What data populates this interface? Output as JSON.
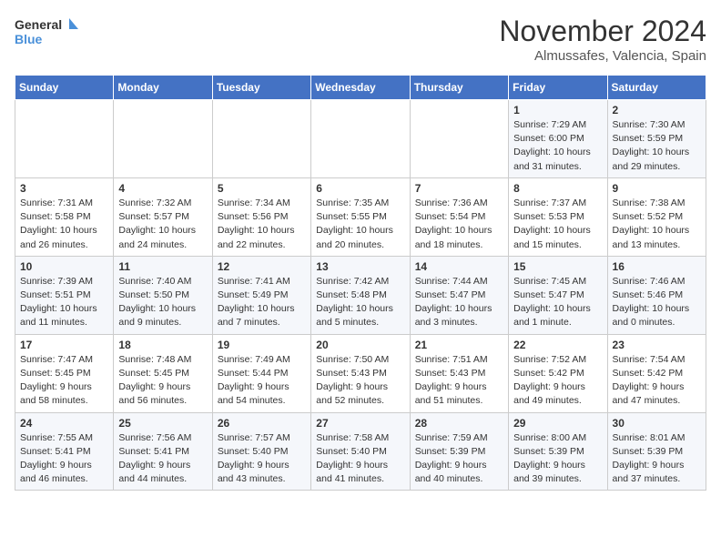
{
  "logo": {
    "line1": "General",
    "line2": "Blue"
  },
  "title": "November 2024",
  "location": "Almussafes, Valencia, Spain",
  "weekdays": [
    "Sunday",
    "Monday",
    "Tuesday",
    "Wednesday",
    "Thursday",
    "Friday",
    "Saturday"
  ],
  "weeks": [
    [
      {
        "day": "",
        "detail": ""
      },
      {
        "day": "",
        "detail": ""
      },
      {
        "day": "",
        "detail": ""
      },
      {
        "day": "",
        "detail": ""
      },
      {
        "day": "",
        "detail": ""
      },
      {
        "day": "1",
        "detail": "Sunrise: 7:29 AM\nSunset: 6:00 PM\nDaylight: 10 hours\nand 31 minutes."
      },
      {
        "day": "2",
        "detail": "Sunrise: 7:30 AM\nSunset: 5:59 PM\nDaylight: 10 hours\nand 29 minutes."
      }
    ],
    [
      {
        "day": "3",
        "detail": "Sunrise: 7:31 AM\nSunset: 5:58 PM\nDaylight: 10 hours\nand 26 minutes."
      },
      {
        "day": "4",
        "detail": "Sunrise: 7:32 AM\nSunset: 5:57 PM\nDaylight: 10 hours\nand 24 minutes."
      },
      {
        "day": "5",
        "detail": "Sunrise: 7:34 AM\nSunset: 5:56 PM\nDaylight: 10 hours\nand 22 minutes."
      },
      {
        "day": "6",
        "detail": "Sunrise: 7:35 AM\nSunset: 5:55 PM\nDaylight: 10 hours\nand 20 minutes."
      },
      {
        "day": "7",
        "detail": "Sunrise: 7:36 AM\nSunset: 5:54 PM\nDaylight: 10 hours\nand 18 minutes."
      },
      {
        "day": "8",
        "detail": "Sunrise: 7:37 AM\nSunset: 5:53 PM\nDaylight: 10 hours\nand 15 minutes."
      },
      {
        "day": "9",
        "detail": "Sunrise: 7:38 AM\nSunset: 5:52 PM\nDaylight: 10 hours\nand 13 minutes."
      }
    ],
    [
      {
        "day": "10",
        "detail": "Sunrise: 7:39 AM\nSunset: 5:51 PM\nDaylight: 10 hours\nand 11 minutes."
      },
      {
        "day": "11",
        "detail": "Sunrise: 7:40 AM\nSunset: 5:50 PM\nDaylight: 10 hours\nand 9 minutes."
      },
      {
        "day": "12",
        "detail": "Sunrise: 7:41 AM\nSunset: 5:49 PM\nDaylight: 10 hours\nand 7 minutes."
      },
      {
        "day": "13",
        "detail": "Sunrise: 7:42 AM\nSunset: 5:48 PM\nDaylight: 10 hours\nand 5 minutes."
      },
      {
        "day": "14",
        "detail": "Sunrise: 7:44 AM\nSunset: 5:47 PM\nDaylight: 10 hours\nand 3 minutes."
      },
      {
        "day": "15",
        "detail": "Sunrise: 7:45 AM\nSunset: 5:47 PM\nDaylight: 10 hours\nand 1 minute."
      },
      {
        "day": "16",
        "detail": "Sunrise: 7:46 AM\nSunset: 5:46 PM\nDaylight: 10 hours\nand 0 minutes."
      }
    ],
    [
      {
        "day": "17",
        "detail": "Sunrise: 7:47 AM\nSunset: 5:45 PM\nDaylight: 9 hours\nand 58 minutes."
      },
      {
        "day": "18",
        "detail": "Sunrise: 7:48 AM\nSunset: 5:45 PM\nDaylight: 9 hours\nand 56 minutes."
      },
      {
        "day": "19",
        "detail": "Sunrise: 7:49 AM\nSunset: 5:44 PM\nDaylight: 9 hours\nand 54 minutes."
      },
      {
        "day": "20",
        "detail": "Sunrise: 7:50 AM\nSunset: 5:43 PM\nDaylight: 9 hours\nand 52 minutes."
      },
      {
        "day": "21",
        "detail": "Sunrise: 7:51 AM\nSunset: 5:43 PM\nDaylight: 9 hours\nand 51 minutes."
      },
      {
        "day": "22",
        "detail": "Sunrise: 7:52 AM\nSunset: 5:42 PM\nDaylight: 9 hours\nand 49 minutes."
      },
      {
        "day": "23",
        "detail": "Sunrise: 7:54 AM\nSunset: 5:42 PM\nDaylight: 9 hours\nand 47 minutes."
      }
    ],
    [
      {
        "day": "24",
        "detail": "Sunrise: 7:55 AM\nSunset: 5:41 PM\nDaylight: 9 hours\nand 46 minutes."
      },
      {
        "day": "25",
        "detail": "Sunrise: 7:56 AM\nSunset: 5:41 PM\nDaylight: 9 hours\nand 44 minutes."
      },
      {
        "day": "26",
        "detail": "Sunrise: 7:57 AM\nSunset: 5:40 PM\nDaylight: 9 hours\nand 43 minutes."
      },
      {
        "day": "27",
        "detail": "Sunrise: 7:58 AM\nSunset: 5:40 PM\nDaylight: 9 hours\nand 41 minutes."
      },
      {
        "day": "28",
        "detail": "Sunrise: 7:59 AM\nSunset: 5:39 PM\nDaylight: 9 hours\nand 40 minutes."
      },
      {
        "day": "29",
        "detail": "Sunrise: 8:00 AM\nSunset: 5:39 PM\nDaylight: 9 hours\nand 39 minutes."
      },
      {
        "day": "30",
        "detail": "Sunrise: 8:01 AM\nSunset: 5:39 PM\nDaylight: 9 hours\nand 37 minutes."
      }
    ]
  ]
}
